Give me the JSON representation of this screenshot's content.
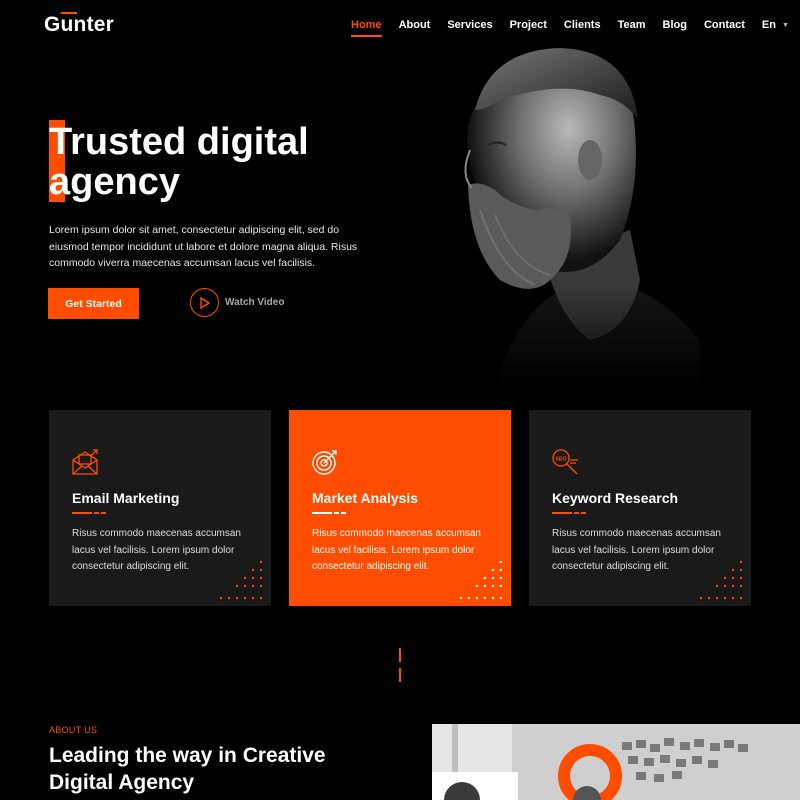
{
  "brand": {
    "logo": "Gunter",
    "accent": "#ff4d00"
  },
  "nav": {
    "items": [
      {
        "label": "Home",
        "active": true
      },
      {
        "label": "About"
      },
      {
        "label": "Services"
      },
      {
        "label": "Project"
      },
      {
        "label": "Clients"
      },
      {
        "label": "Team"
      },
      {
        "label": "Blog"
      },
      {
        "label": "Contact"
      }
    ],
    "language": "En"
  },
  "hero": {
    "title_line1": "Trusted digital",
    "title_line2": "agency",
    "description": "Lorem ipsum dolor sit amet, consectetur adipiscing elit, sed do eiusmod tempor incididunt ut labore et dolore magna aliqua. Risus commodo viverra maecenas accumsan lacus vel facilisis.",
    "cta_label": "Get Started",
    "video_label": "Watch Video"
  },
  "services": [
    {
      "title": "Email Marketing",
      "icon": "email-marketing-icon",
      "text": "Risus commodo maecenas accumsan lacus vel facilisis. Lorem ipsum dolor consectetur adipiscing elit."
    },
    {
      "title": "Market Analysis",
      "icon": "target-icon",
      "text": "Risus commodo maecenas accumsan lacus vel facilisis. Lorem ipsum dolor consectetur adipiscing elit."
    },
    {
      "title": "Keyword Research",
      "icon": "seo-search-icon",
      "text": "Risus commodo maecenas accumsan lacus vel facilisis. Lorem ipsum dolor consectetur adipiscing elit."
    }
  ],
  "about": {
    "kicker": "ABOUT US",
    "title": "Leading the way in Creative Digital Agency"
  }
}
